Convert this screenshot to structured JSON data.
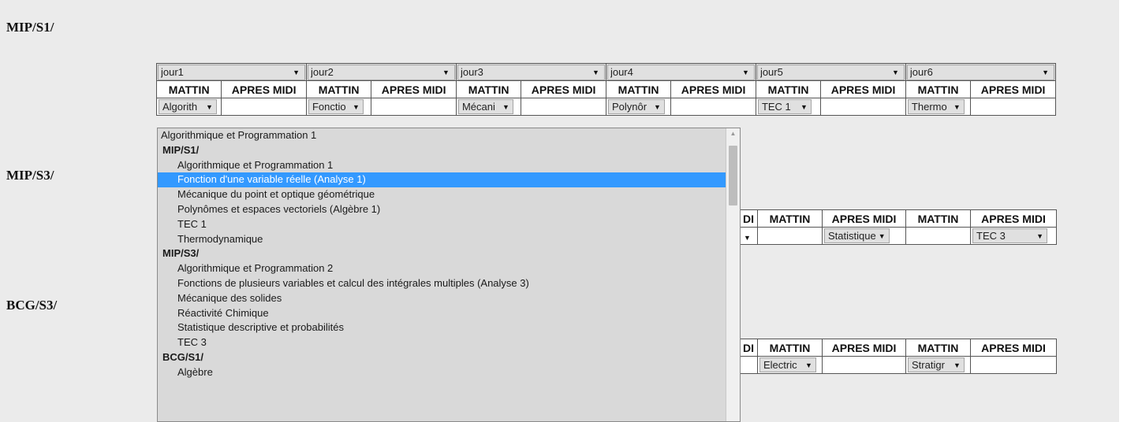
{
  "sections": [
    {
      "title": "MIP/S1/"
    },
    {
      "title": "MIP/S3/"
    },
    {
      "title": "BCG/S3/"
    }
  ],
  "schedule1": {
    "days": [
      "jour1",
      "jour2",
      "jour3",
      "jour4",
      "jour5",
      "jour6"
    ],
    "col_mattin": "MATTIN",
    "col_apres": "APRES MIDI",
    "row": [
      "Algorith",
      "Fonctio",
      "Mécani",
      "Polynôr",
      "TEC 1",
      "Thermo"
    ]
  },
  "schedule2": {
    "headers": [
      "DI",
      "MATTIN",
      "APRES MIDI",
      "MATTIN",
      "APRES MIDI"
    ],
    "sel1": "Statistique",
    "sel2": "TEC 3"
  },
  "schedule3": {
    "headers": [
      "DI",
      "MATTIN",
      "APRES MIDI",
      "MATTIN",
      "APRES MIDI"
    ],
    "sel1": "Electric",
    "sel2": "Stratigr"
  },
  "dropdown": {
    "options": [
      {
        "label": "Algorithmique et Programmation 1",
        "type": "current"
      },
      {
        "label": "MIP/S1/",
        "type": "group"
      },
      {
        "label": "Algorithmique et Programmation 1",
        "type": "item"
      },
      {
        "label": "Fonction d'une variable réelle (Analyse 1)",
        "type": "item",
        "selected": true
      },
      {
        "label": "Mécanique du point et optique géométrique",
        "type": "item"
      },
      {
        "label": "Polynômes et espaces vectoriels (Algèbre 1)",
        "type": "item"
      },
      {
        "label": "TEC 1",
        "type": "item"
      },
      {
        "label": "Thermodynamique",
        "type": "item"
      },
      {
        "label": "MIP/S3/",
        "type": "group"
      },
      {
        "label": "Algorithmique et Programmation 2",
        "type": "item"
      },
      {
        "label": "Fonctions de plusieurs variables et calcul des intégrales multiples (Analyse 3)",
        "type": "item"
      },
      {
        "label": "Mécanique des solides",
        "type": "item"
      },
      {
        "label": "Réactivité Chimique",
        "type": "item"
      },
      {
        "label": "Statistique descriptive et probabilités",
        "type": "item"
      },
      {
        "label": "TEC 3",
        "type": "item"
      },
      {
        "label": "BCG/S1/",
        "type": "group"
      },
      {
        "label": "Algèbre",
        "type": "item"
      }
    ]
  },
  "icons": {
    "dropdown_arrow": "▼",
    "scroll_up": "▲"
  },
  "colors": {
    "selected_option": "#3399ff",
    "page_background": "#ebebeb"
  }
}
